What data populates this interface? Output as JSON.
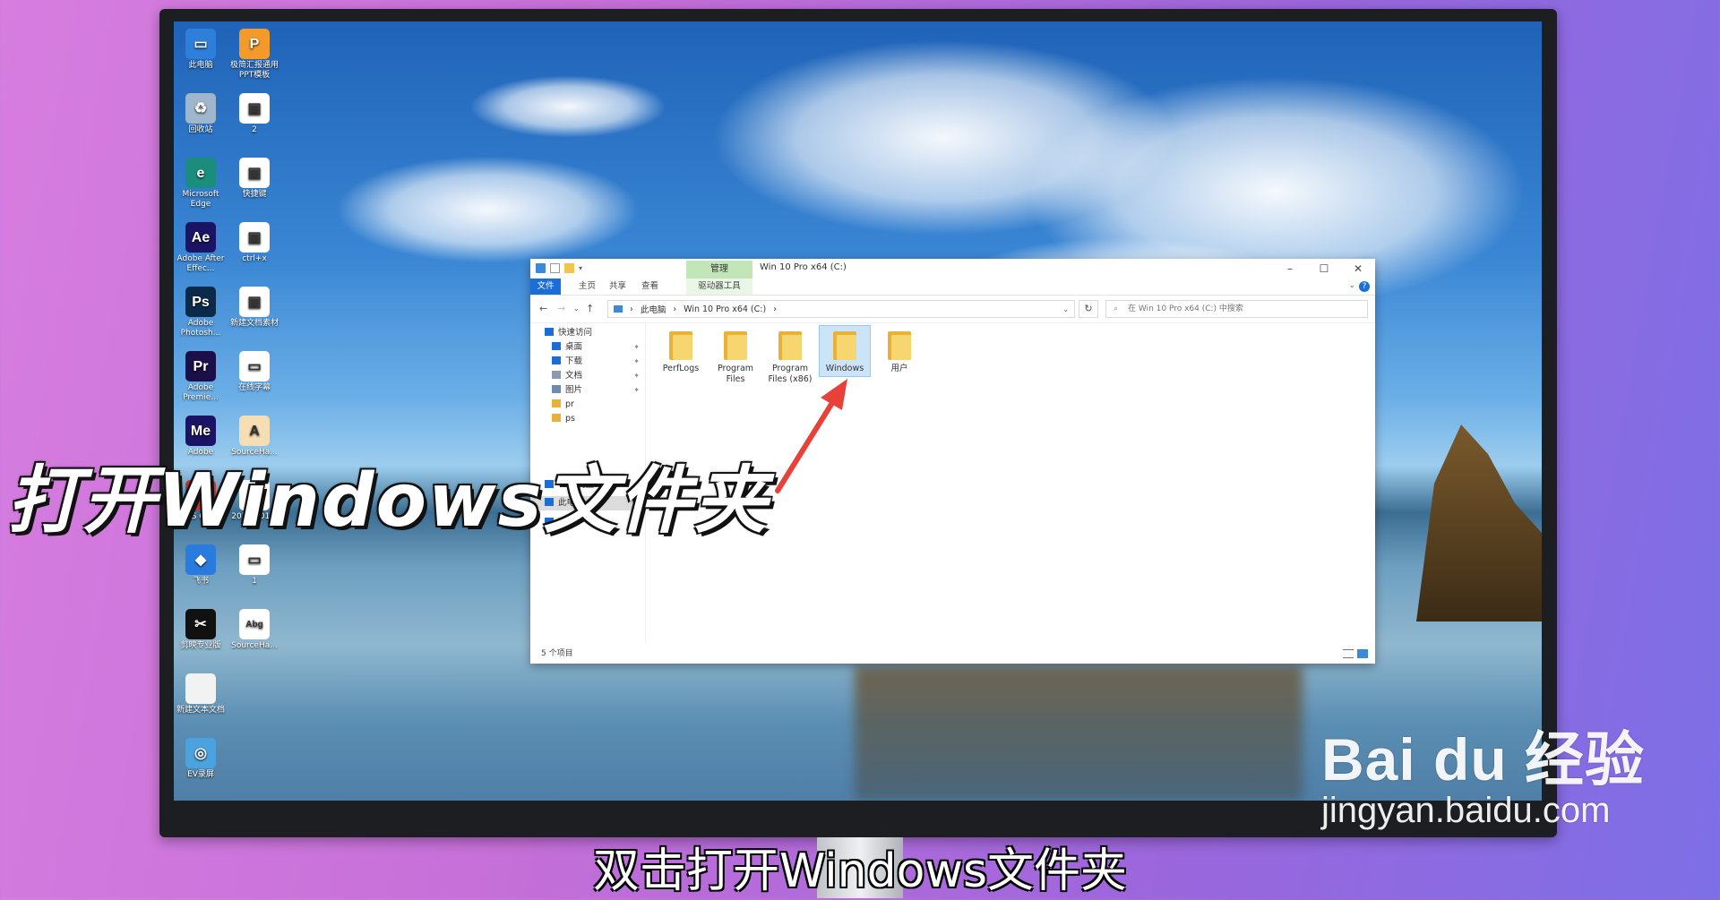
{
  "desktop": {
    "icons_col1": [
      {
        "label": "此电脑",
        "color": "#2e7fd9",
        "glyph": "▭",
        "icon": "computer-icon"
      },
      {
        "label": "回收站",
        "color": "#9fb6cc",
        "glyph": "♻",
        "icon": "recycle-bin-icon"
      },
      {
        "label": "Microsoft Edge",
        "color": "#1a8d7c",
        "glyph": "e",
        "icon": "edge-icon"
      },
      {
        "label": "Adobe After Effec...",
        "color": "#1b1464",
        "glyph": "Ae",
        "icon": "after-effects-icon"
      },
      {
        "label": "Adobe Photosh...",
        "color": "#0b2a4a",
        "glyph": "Ps",
        "icon": "photoshop-icon"
      },
      {
        "label": "Adobe Premie...",
        "color": "#1b0f4a",
        "glyph": "Pr",
        "icon": "premiere-icon"
      },
      {
        "label": "Adobe",
        "color": "#1b1464",
        "glyph": "Me",
        "icon": "media-encoder-icon"
      },
      {
        "label": "WPS Office",
        "color": "#c8362b",
        "glyph": "W",
        "icon": "wps-office-icon"
      },
      {
        "label": "飞书",
        "color": "#2a7bde",
        "glyph": "◆",
        "icon": "feishu-icon"
      },
      {
        "label": "剪映专业版",
        "color": "#111111",
        "glyph": "✂",
        "icon": "jianying-icon"
      },
      {
        "label": "新建文本文档",
        "color": "#f2f2f2",
        "glyph": "",
        "icon": "text-document-icon"
      },
      {
        "label": "EV录屏",
        "color": "#4aa3df",
        "glyph": "◎",
        "icon": "ev-recorder-icon"
      }
    ],
    "icons_col2": [
      {
        "label": "极简汇报通用PPT模板",
        "color": "#f39a2b",
        "glyph": "P",
        "icon": "ppt-file-icon"
      },
      {
        "label": "2",
        "color": "#ffffff",
        "glyph": "▣",
        "icon": "image-file-icon"
      },
      {
        "label": "快捷键",
        "color": "#ffffff",
        "glyph": "▣",
        "icon": "video-file-icon"
      },
      {
        "label": "ctrl+x",
        "color": "#ffffff",
        "glyph": "▣",
        "icon": "video-file-icon"
      },
      {
        "label": "新建文档素材",
        "color": "#ffffff",
        "glyph": "▣",
        "icon": "video-file-icon"
      },
      {
        "label": "在线字幕",
        "color": "#ffffff",
        "glyph": "▭",
        "icon": "video-file-icon"
      },
      {
        "label": "SourceHa...",
        "color": "#f5deb3",
        "glyph": "A",
        "icon": "font-file-icon"
      },
      {
        "label": "2022.201...",
        "color": "#ffffff",
        "glyph": "▭",
        "icon": "file-icon"
      },
      {
        "label": "1",
        "color": "#ffffff",
        "glyph": "▭",
        "icon": "file-icon"
      },
      {
        "label": "SourceHa...",
        "color": "#ffffff",
        "glyph": "Abg",
        "icon": "font-file-icon"
      }
    ]
  },
  "explorer": {
    "ribbon_context": "管理",
    "title": "Win 10 Pro x64 (C:)",
    "tabs": [
      "文件",
      "主页",
      "共享",
      "查看"
    ],
    "context_tab": "驱动器工具",
    "address": [
      "此电脑",
      "Win 10 Pro x64 (C:)"
    ],
    "search_placeholder": "在 Win 10 Pro x64 (C:) 中搜索",
    "nav": [
      {
        "label": "快速访问",
        "icon": "star-icon",
        "color": "#1a6ed8",
        "pinned": false,
        "indent": 0
      },
      {
        "label": "桌面",
        "icon": "desktop-folder-icon",
        "color": "#1a6ed8",
        "pinned": true,
        "indent": 1
      },
      {
        "label": "下载",
        "icon": "download-icon",
        "color": "#1a6ed8",
        "pinned": true,
        "indent": 1
      },
      {
        "label": "文档",
        "icon": "document-icon",
        "color": "#8a9ab0",
        "pinned": true,
        "indent": 1
      },
      {
        "label": "图片",
        "icon": "picture-icon",
        "color": "#6c8cab",
        "pinned": true,
        "indent": 1
      },
      {
        "label": "pr",
        "icon": "folder-icon",
        "color": "#e8b23a",
        "pinned": false,
        "indent": 1
      },
      {
        "label": "ps",
        "icon": "folder-icon",
        "color": "#e8b23a",
        "pinned": false,
        "indent": 1
      },
      {
        "label": "WPS网盘",
        "icon": "cloud-icon",
        "color": "#1a6ed8",
        "pinned": false,
        "indent": 0
      },
      {
        "label": "此电脑",
        "icon": "computer-icon",
        "color": "#1a6ed8",
        "pinned": false,
        "indent": 0,
        "selected": true
      },
      {
        "label": "网络",
        "icon": "network-icon",
        "color": "#1a6ed8",
        "pinned": false,
        "indent": 0
      }
    ],
    "folders": [
      {
        "name": "PerfLogs"
      },
      {
        "name": "Program Files"
      },
      {
        "name": "Program Files (x86)"
      },
      {
        "name": "Windows",
        "selected": true
      },
      {
        "name": "用户"
      }
    ],
    "status": "5 个项目"
  },
  "overlay": {
    "title_caption": "打开Windows文件夹",
    "subtitle": "双击打开Windows文件夹",
    "watermark_brand": "Bai du 经验",
    "watermark_url": "jingyan.baidu.com"
  },
  "colors": {
    "accent": "#1a6ed8",
    "manage": "#c3e6b8",
    "arrow": "#e8413a"
  }
}
